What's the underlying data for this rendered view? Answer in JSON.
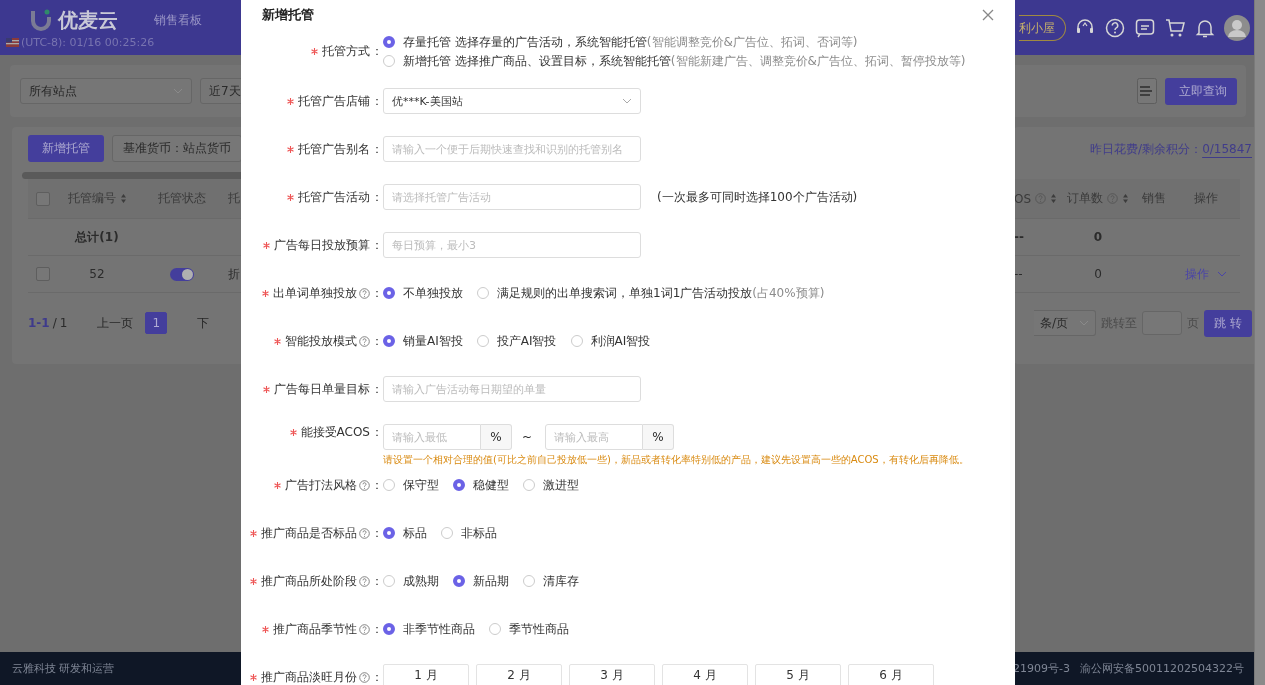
{
  "header": {
    "logo": "优麦云",
    "nav_item": "销售看板",
    "clock": "(UTC-8): 01/16 00:25:26",
    "promo_button": "利小屋"
  },
  "filters": {
    "site_select": {
      "placeholder": "所有站点"
    },
    "date_select": {
      "value": "近7天"
    },
    "query_button": "立即查询"
  },
  "toolbar": {
    "add_button": "新增托管",
    "currency_button": "基准货币：站点货币",
    "credits_label": "昨日花费/剩余积分：",
    "credits_value": "0/15847"
  },
  "table": {
    "header_checkbox": {
      "checked": false
    },
    "left_columns": [
      {
        "label": "托管编号",
        "sortable": true
      },
      {
        "label": "托管状态"
      },
      {
        "label": "托"
      }
    ],
    "right_columns": [
      {
        "label": "OS",
        "sortable": true,
        "help": true
      },
      {
        "label": "订单数",
        "sortable": true,
        "help": true
      },
      {
        "label": "销售"
      },
      {
        "label": "操作"
      }
    ],
    "total_row": {
      "label": "总计(1)",
      "right_cells": [
        "--",
        "0"
      ]
    },
    "rows": [
      {
        "checked": false,
        "id": "52",
        "enabled": true,
        "column_3": "折",
        "right_cells": [
          "--",
          "0"
        ],
        "action": "操作"
      }
    ]
  },
  "pagination": {
    "range": "1-1",
    "separator": "/",
    "total": "1",
    "prev": "上一页",
    "pages": [
      {
        "label": "1",
        "selected": true
      }
    ],
    "next": "下",
    "page_size": "条/页",
    "jump_label": "跳转至",
    "page_unit": "页",
    "jump_button": "跳 转"
  },
  "footer": {
    "company": "云雅科技 研发和运营",
    "icp": "21909号-3",
    "police": "渝公网安备50011202504322号"
  },
  "dialog": {
    "title": "新增托管",
    "fields": [
      {
        "kind": "radio",
        "label": "托管方式",
        "colon": "：",
        "required": true,
        "vertical": true,
        "options": [
          {
            "label": "存量托管 选择存量的广告活动，系统智能托管",
            "note": "(智能调整竞价&广告位、拓词、否词等)",
            "selected": true
          },
          {
            "label": "新增托管 选择推广商品、设置目标，系统智能托管",
            "note": " (智能新建广告、调整竞价&广告位、拓词、暂停投放等)",
            "selected": false
          }
        ]
      },
      {
        "kind": "select",
        "label": "托管广告店铺",
        "colon": "：",
        "required": true,
        "value": "优***K-美国站"
      },
      {
        "kind": "input",
        "label": "托管广告别名",
        "colon": "：",
        "required": true,
        "placeholder": "请输入一个便于后期快速查找和识别的托管别名"
      },
      {
        "kind": "input",
        "label": "托管广告活动",
        "colon": "：",
        "required": true,
        "placeholder": "请选择托管广告活动",
        "hint": "(一次最多可同时选择100个广告活动)"
      },
      {
        "kind": "input",
        "label": "广告每日投放预算",
        "colon": "：",
        "required": true,
        "placeholder": "每日预算，最小3"
      },
      {
        "kind": "radio",
        "label": "出单词单独投放",
        "colon": "：",
        "required": true,
        "help": true,
        "options": [
          {
            "label": "不单独投放",
            "selected": true
          },
          {
            "label": "满足规则的出单搜索词，单独1词1广告活动投放",
            "note": "(占40%预算)",
            "selected": false
          }
        ]
      },
      {
        "kind": "radio",
        "label": "智能投放模式",
        "colon": "：",
        "required": true,
        "help": true,
        "options": [
          {
            "label": "销量AI智投",
            "selected": true
          },
          {
            "label": "投产AI智投",
            "selected": false
          },
          {
            "label": "利润AI智投",
            "selected": false
          }
        ]
      },
      {
        "kind": "input",
        "label": "广告每日单量目标",
        "colon": "：",
        "required": true,
        "placeholder": "请输入广告活动每日期望的单量"
      },
      {
        "kind": "range",
        "label": "能接受ACOS",
        "colon": "：",
        "required": true,
        "min_placeholder": "请输入最低",
        "max_placeholder": "请输入最高",
        "unit": "%",
        "separator": "~",
        "warning": "请设置一个相对合理的值(可比之前自己投放低一些)，新品或者转化率特别低的产品，建议先设置高一些的ACOS，有转化后再降低。"
      },
      {
        "kind": "radio",
        "label": "广告打法风格",
        "colon": "：",
        "required": true,
        "help": true,
        "options": [
          {
            "label": "保守型",
            "selected": false
          },
          {
            "label": "稳健型",
            "selected": true
          },
          {
            "label": "激进型",
            "selected": false
          }
        ]
      },
      {
        "kind": "radio",
        "label": "推广商品是否标品",
        "colon": "：",
        "required": true,
        "help": true,
        "options": [
          {
            "label": "标品",
            "selected": true
          },
          {
            "label": "非标品",
            "selected": false
          }
        ]
      },
      {
        "kind": "radio",
        "label": "推广商品所处阶段",
        "colon": "：",
        "required": true,
        "help": true,
        "options": [
          {
            "label": "成熟期",
            "selected": false
          },
          {
            "label": "新品期",
            "selected": true
          },
          {
            "label": "清库存",
            "selected": false
          }
        ]
      },
      {
        "kind": "radio",
        "label": "推广商品季节性",
        "colon": "：",
        "required": true,
        "help": true,
        "options": [
          {
            "label": "非季节性商品",
            "selected": true
          },
          {
            "label": "季节性商品",
            "selected": false
          }
        ]
      },
      {
        "kind": "months",
        "label": "推广商品淡旺月份",
        "colon": "：",
        "required": true,
        "help": true,
        "months": [
          "1 月",
          "2 月",
          "3 月",
          "4 月",
          "5 月",
          "6 月"
        ]
      }
    ]
  }
}
